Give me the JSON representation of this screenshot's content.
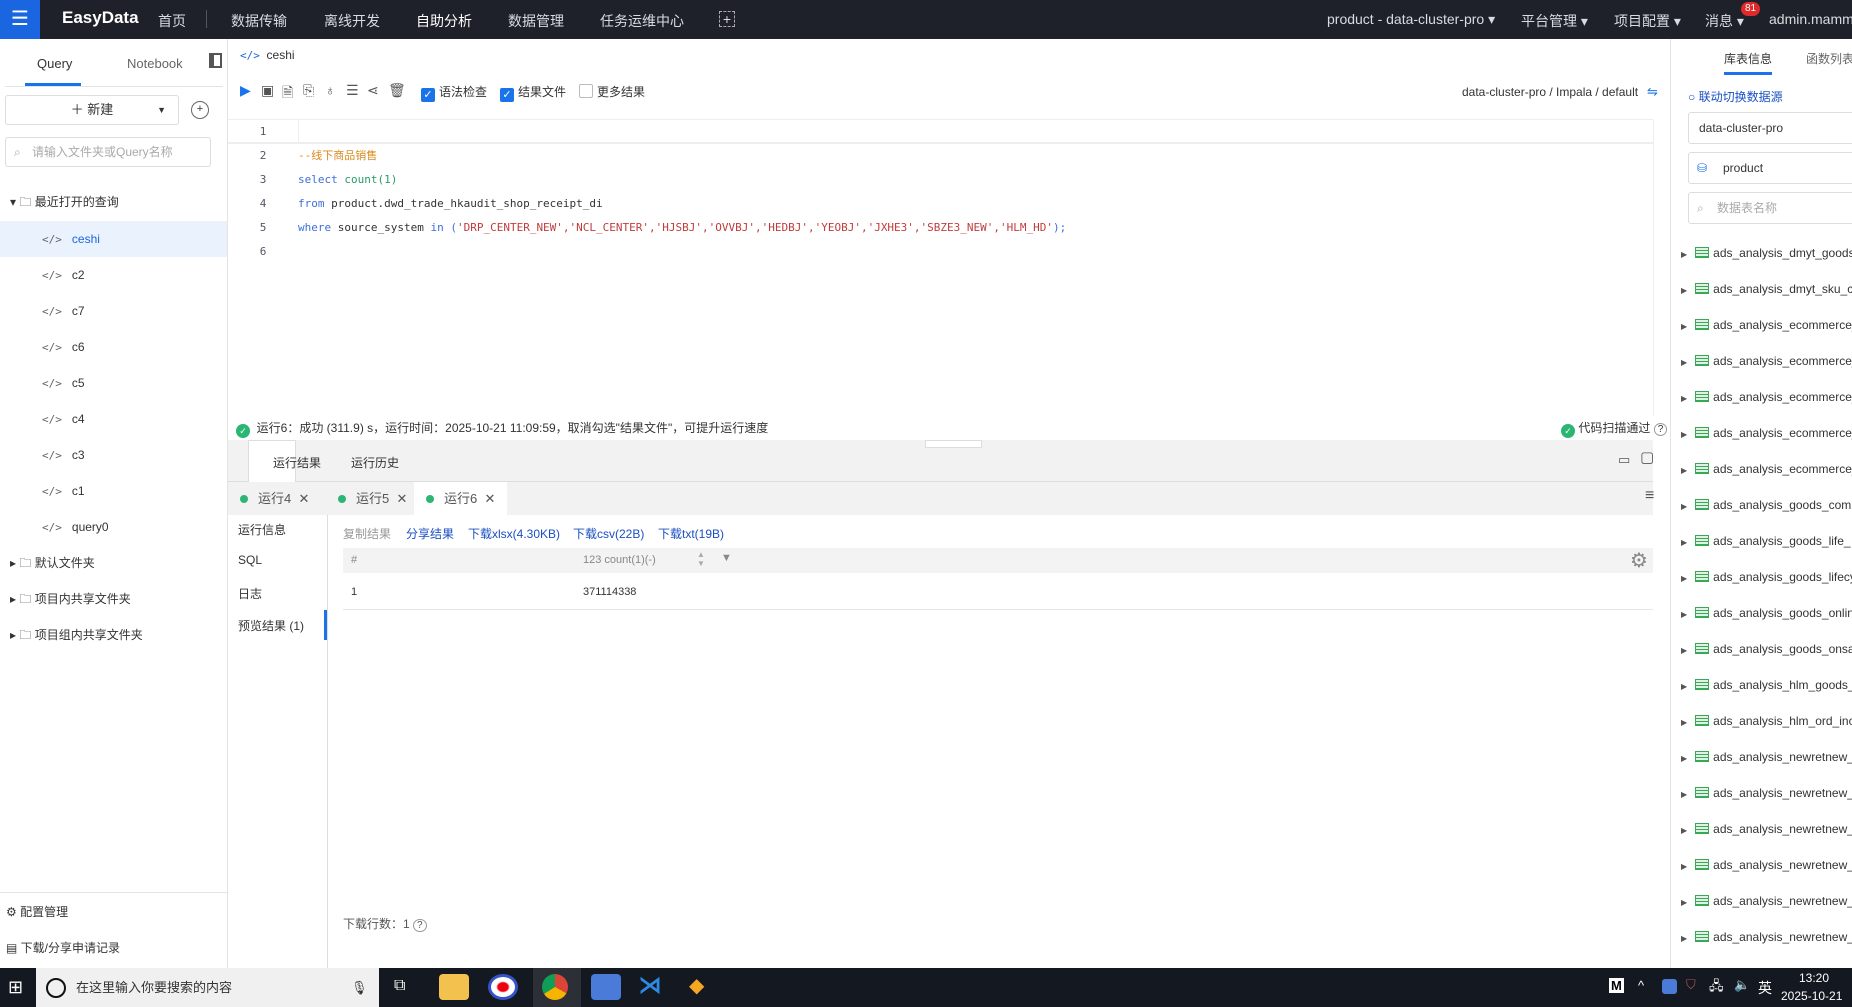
{
  "nav": {
    "logo": "EasyData",
    "items": [
      "首页",
      "数据传输",
      "离线开发",
      "自助分析",
      "数据管理",
      "任务运维中心"
    ],
    "active": "自助分析",
    "project": "product - data-cluster-pro ▾",
    "platform": "平台管理 ▾",
    "config": "项目配置 ▾",
    "messages": "消息 ▾",
    "badge": "81",
    "user": "admin.mammut"
  },
  "left": {
    "tabs": [
      "Query",
      "Notebook"
    ],
    "new_label": "新建",
    "search_placeholder": "请输入文件夹或Query名称",
    "recent": "最近打开的查询",
    "queries": [
      "ceshi",
      "c2",
      "c7",
      "c6",
      "c5",
      "c4",
      "c3",
      "c1",
      "query0"
    ],
    "folders": [
      "默认文件夹",
      "项目内共享文件夹",
      "项目组内共享文件夹"
    ],
    "config": "配置管理",
    "records": "下载/分享申请记录"
  },
  "editor": {
    "tab": "ceshi",
    "checks": [
      {
        "label": "语法检查",
        "checked": true
      },
      {
        "label": "结果文件",
        "checked": true
      },
      {
        "label": "更多结果",
        "checked": false
      }
    ],
    "datasource": "data-cluster-pro / Impala / default",
    "lines": [
      "1",
      "2",
      "3",
      "4",
      "5",
      "6"
    ],
    "code": {
      "comment": "--线下商品销售",
      "l3a": "select ",
      "l3b": "count",
      "l3c": "(1)",
      "l4a": "from ",
      "l4b": "product.dwd_trade_hkaudit_shop_receipt_di",
      "l5a": "where ",
      "l5b": "source_system ",
      "l5c": "in ",
      "l5d": "(",
      "l5e": "'DRP_CENTER_NEW','NCL_CENTER','HJSBJ','OVVBJ','HEDBJ','YEOBJ','JXHE3','SBZE3_NEW','HLM_HD'",
      "l5f": ");"
    }
  },
  "status": {
    "text": "运行6：成功 (311.9) s，运行时间：2025-10-21 11:09:59，取消勾选\"结果文件\"，可提升运行速度",
    "scan": "代码扫描通过"
  },
  "results": {
    "tabs": [
      "运行结果",
      "运行历史"
    ],
    "runs": [
      "运行4",
      "运行5",
      "运行6"
    ],
    "subnav": [
      "运行信息",
      "SQL",
      "日志",
      "预览结果 (1)"
    ],
    "actions": [
      "复制结果",
      "分享结果",
      "下载xlsx(4.30KB)",
      "下载csv(22B)",
      "下载txt(19B)"
    ],
    "columns": [
      "#",
      "123 count(1)(-)"
    ],
    "rows": [
      [
        "1",
        "371114338"
      ]
    ],
    "download_rows": "下载行数：1"
  },
  "right": {
    "tabs": [
      "库表信息",
      "函数列表"
    ],
    "link": "联动切换数据源",
    "cluster": "data-cluster-pro",
    "db": "product",
    "search_placeholder": "数据表名称",
    "tables": [
      "ads_analysis_dmyt_goods",
      "ads_analysis_dmyt_sku_c",
      "ads_analysis_ecommerce_",
      "ads_analysis_ecommerce_",
      "ads_analysis_ecommerce_",
      "ads_analysis_ecommerce_",
      "ads_analysis_ecommerce_",
      "ads_analysis_goods_comp",
      "ads_analysis_goods_life_",
      "ads_analysis_goods_lifecy",
      "ads_analysis_goods_onlin",
      "ads_analysis_goods_onsa",
      "ads_analysis_hlm_goods_",
      "ads_analysis_hlm_ord_inc",
      "ads_analysis_newretnew_",
      "ads_analysis_newretnew_",
      "ads_analysis_newretnew_",
      "ads_analysis_newretnew_",
      "ads_analysis_newretnew_",
      "ads_analysis_newretnew_"
    ]
  },
  "taskbar": {
    "search": "在这里输入你要搜索的内容",
    "ime": "英",
    "time": "13:20",
    "date": "2025-10-21"
  }
}
